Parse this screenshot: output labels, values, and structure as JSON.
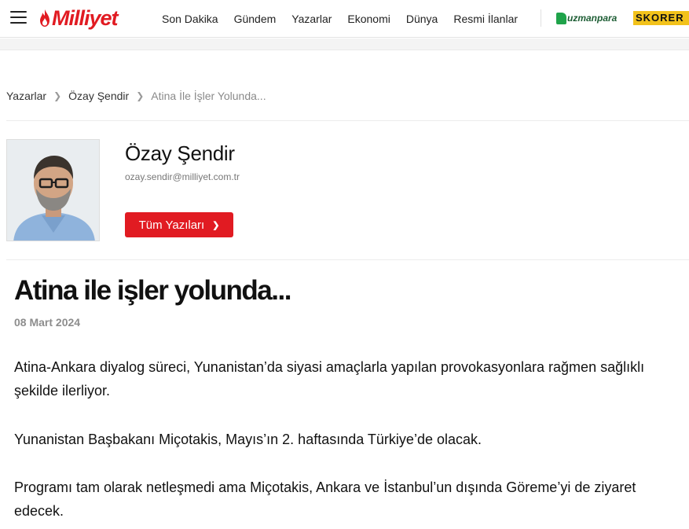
{
  "header": {
    "logo_text": "Milliyet",
    "nav": [
      "Son Dakika",
      "Gündem",
      "Yazarlar",
      "Ekonomi",
      "Dünya",
      "Resmi İlanlar"
    ],
    "partner_uzmanpara": "uzmanpara",
    "partner_skorer": "SKORER",
    "brand_color": "#e11b22"
  },
  "breadcrumb": {
    "items": [
      "Yazarlar",
      "Özay Şendir"
    ],
    "current": "Atina İle İşler Yolunda..."
  },
  "author": {
    "name": "Özay Şendir",
    "email": "ozay.sendir@milliyet.com.tr",
    "all_posts_label": "Tüm Yazıları"
  },
  "article": {
    "title": "Atina ile işler yolunda...",
    "date": "08 Mart 2024",
    "paragraphs": [
      "Atina-Ankara diyalog süreci, Yunanistan’da siyasi amaçlarla yapılan provokasyonlara rağmen sağlıklı şekilde ilerliyor.",
      "Yunanistan Başbakanı Miçotakis, Mayıs’ın 2. haftasında Türkiye’de olacak.",
      "Programı tam olarak netleşmedi ama Miçotakis, Ankara ve İstanbul’un dışında Göreme’yi de ziyaret edecek."
    ]
  }
}
